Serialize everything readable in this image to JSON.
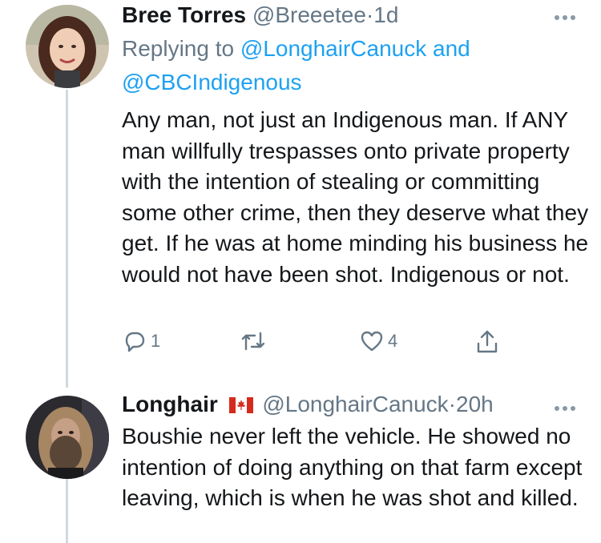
{
  "tweets": [
    {
      "name": "Bree Torres",
      "handle": "@Breeetee",
      "separator": "·",
      "time": "1d",
      "replying_prefix": "Replying to",
      "mention1": "@LonghairCanuck",
      "and_word": "and",
      "mention2": "@CBCIndigenous",
      "text": "Any man, not just an Indigenous man. If ANY man willfully trespasses onto private property with the intention of stealing or committing some other crime, then they deserve what they get. If he was at home minding his business he would not have been shot. Indigenous or not.",
      "reply_count": "1",
      "like_count": "4"
    },
    {
      "name": "Longhair",
      "flag_icon": "canada-flag-icon",
      "handle": "@LonghairCanuck",
      "separator": "·",
      "time": "20h",
      "text": "Boushie never left the vehicle. He showed no intention of doing anything on that farm except leaving, which is when he was shot and killed."
    }
  ],
  "colors": {
    "text": "#14171a",
    "secondary": "#657786",
    "link": "#1da1f2",
    "thread_line": "#cfd9de"
  }
}
